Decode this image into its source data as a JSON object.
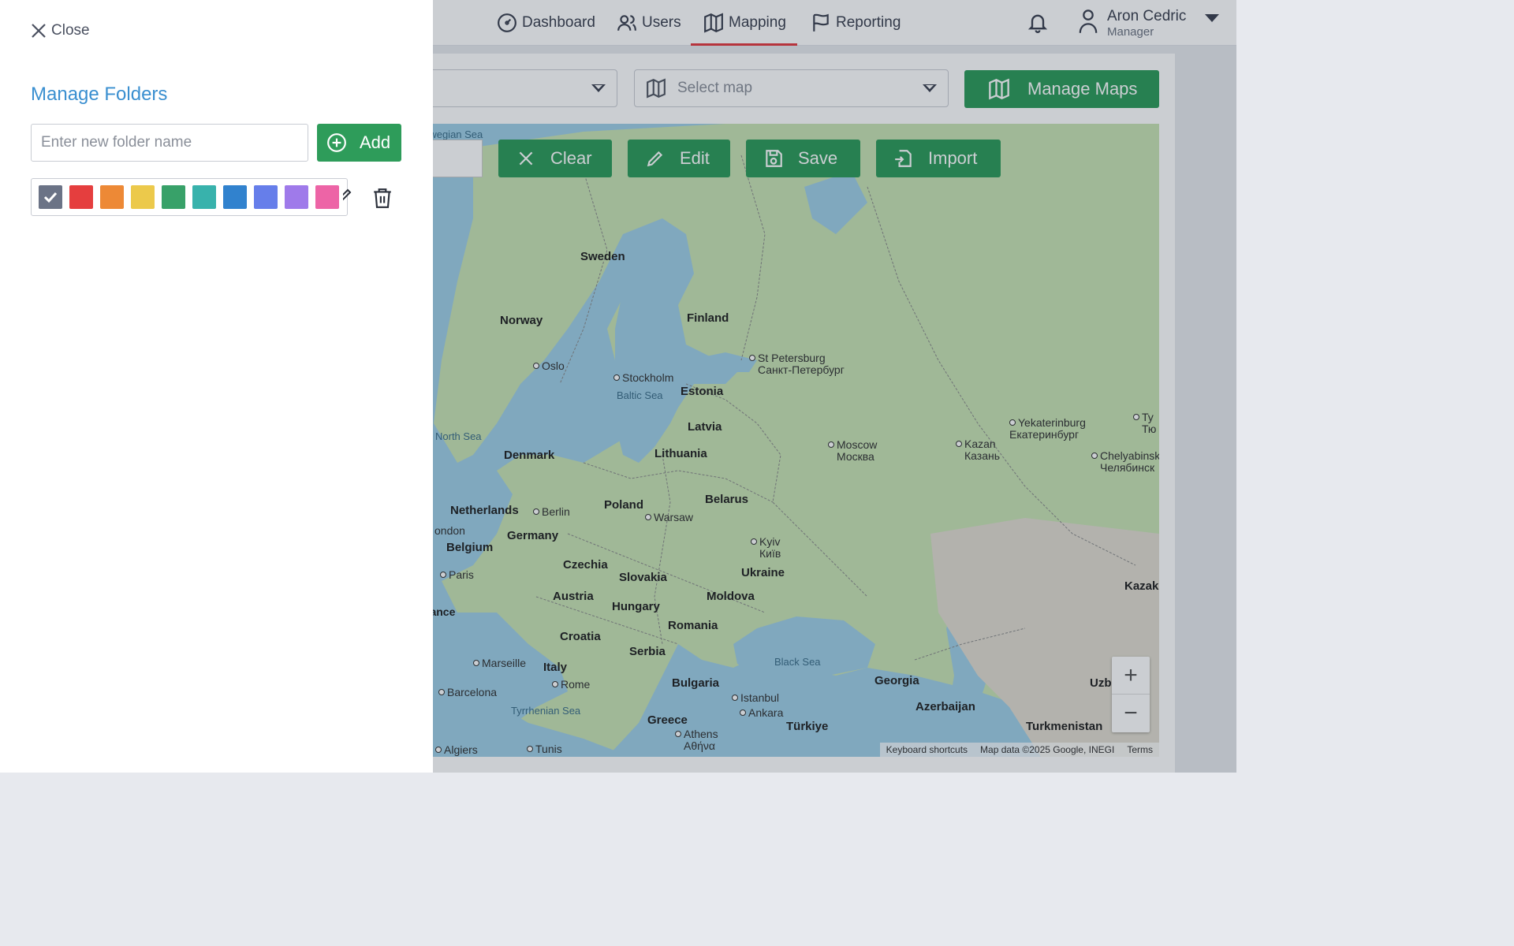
{
  "nav": {
    "dashboard": "Dashboard",
    "users": "Users",
    "mapping": "Mapping",
    "reporting": "Reporting",
    "active": "Mapping"
  },
  "user": {
    "name": "Aron Cedric",
    "role": "Manager"
  },
  "toolbar": {
    "map_select_placeholder": "Select map",
    "manage_maps_label": "Manage Maps"
  },
  "map_tools": {
    "clear": "Clear",
    "edit": "Edit",
    "save": "Save",
    "import": "Import"
  },
  "map": {
    "countries": [
      "Sweden",
      "Norway",
      "Finland",
      "Estonia",
      "Latvia",
      "Lithuania",
      "Denmark",
      "Netherlands",
      "Belgium",
      "Germany",
      "Poland",
      "Belarus",
      "Czechia",
      "Slovakia",
      "Austria",
      "Hungary",
      "Ukraine",
      "Moldova",
      "Romania",
      "Croatia",
      "Serbia",
      "Italy",
      "Bulgaria",
      "Greece",
      "Georgia",
      "Azerbaijan",
      "Türkiye",
      "Turkmenistan",
      "Kazak",
      "Uzb"
    ],
    "cities": [
      "Oslo",
      "Stockholm",
      "St Petersburg",
      "Санкт-Петербург",
      "Moscow",
      "Москва",
      "Kazan",
      "Казань",
      "Yekaterinburg",
      "Екатеринбург",
      "Chelyabinsk",
      "Челябинск",
      "Berlin",
      "Warsaw",
      "Kyiv",
      "Київ",
      "Paris",
      "Marseille",
      "Barcelona",
      "Rome",
      "Istanbul",
      "Ankara",
      "Athens",
      "Αθήνα",
      "Algiers",
      "Tunis",
      "London"
    ],
    "seas": [
      "Norwegian Sea",
      "Baltic Sea",
      "North Sea",
      "Black Sea",
      "Tyrrhenian Sea"
    ],
    "france_partial": "rance",
    "london_partial": "ondon",
    "norwegian_partial": "rwegian Sea",
    "tyumen_partial_1": "Ty",
    "tyumen_partial_2": "Тю",
    "uzb_suffix": "n",
    "zoom_in": "+",
    "zoom_out": "−",
    "attribution": [
      "Keyboard shortcuts",
      "Map data ©2025 Google, INEGI",
      "Terms"
    ]
  },
  "drawer": {
    "close_label": "Close",
    "title": "Manage Folders",
    "input_placeholder": "Enter new folder name",
    "input_value": "",
    "add_label": "Add",
    "selected_color": "#6b7386",
    "colors": [
      "#6b7386",
      "#e53e3e",
      "#ed8936",
      "#ecc94b",
      "#38a169",
      "#38b2ac",
      "#3182ce",
      "#667eea",
      "#9f7aea",
      "#ed64a6"
    ]
  },
  "accent_colors": {
    "primary_green": "#2e9c5a",
    "title_blue": "#3a8fd0",
    "active_tab": "#e53a40"
  }
}
